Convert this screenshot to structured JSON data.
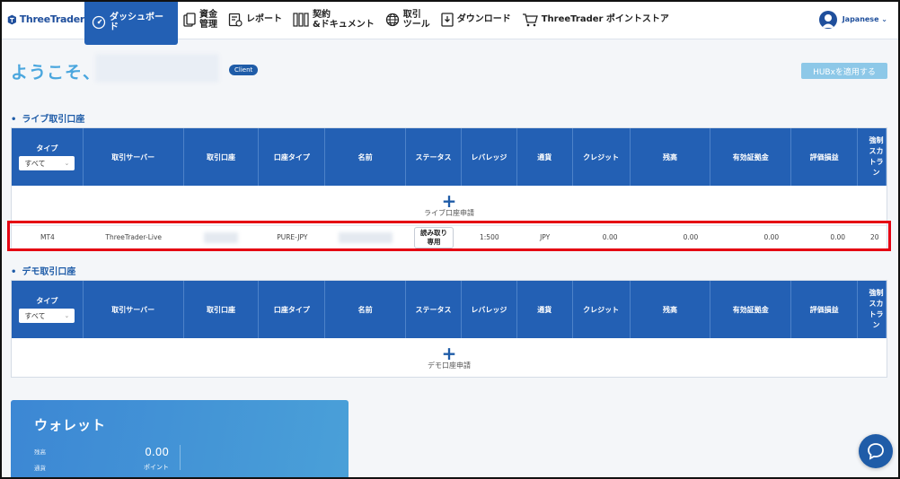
{
  "header": {
    "logo": "ThreeTrader",
    "nav": [
      {
        "label": "ダッシュボード",
        "icon": "dashboard-icon",
        "active": true
      },
      {
        "label": "資金\n管理",
        "icon": "funds-icon"
      },
      {
        "label": "レポート",
        "icon": "report-icon"
      },
      {
        "label": "契約\n&ドキュメント",
        "icon": "documents-icon"
      },
      {
        "label": "取引\nツール",
        "icon": "globe-icon"
      },
      {
        "label": "ダウンロード",
        "icon": "download-icon"
      },
      {
        "label": "ThreeTrader ポイントストア",
        "icon": "cart-icon"
      }
    ],
    "language": "Japanese"
  },
  "welcome": {
    "text": "ようこそ、",
    "badge": "Client",
    "hubx_button": "HUBxを適用する"
  },
  "columns": [
    "タイプ",
    "取引サーバー",
    "取引口座",
    "口座タイプ",
    "名前",
    "ステータス",
    "レバレッジ",
    "通貨",
    "クレジット",
    "残高",
    "有効証拠金",
    "評価損益",
    "強制\nスカ\nトラン"
  ],
  "type_filter": "すべて",
  "live": {
    "title": "ライブ取引口座",
    "add_label": "ライブ口座申請",
    "row": {
      "type": "MT4",
      "server": "ThreeTrader-Live",
      "account_type": "PURE-JPY",
      "status": "読み取り\n専用",
      "leverage": "1:500",
      "currency": "JPY",
      "credit": "0.00",
      "balance": "0.00",
      "equity": "0.00",
      "pnl": "0.00",
      "stopout": "20"
    }
  },
  "demo": {
    "title": "デモ取引口座",
    "add_label": "デモ口座申請"
  },
  "wallet": {
    "title": "ウォレット",
    "balance_label": "残高",
    "currency_label": "通貨",
    "balance_value": "0.00",
    "unit": "ポイント"
  },
  "colors": {
    "primary": "#2360b4",
    "accent": "#4aa6de",
    "highlight": "#e50012"
  }
}
